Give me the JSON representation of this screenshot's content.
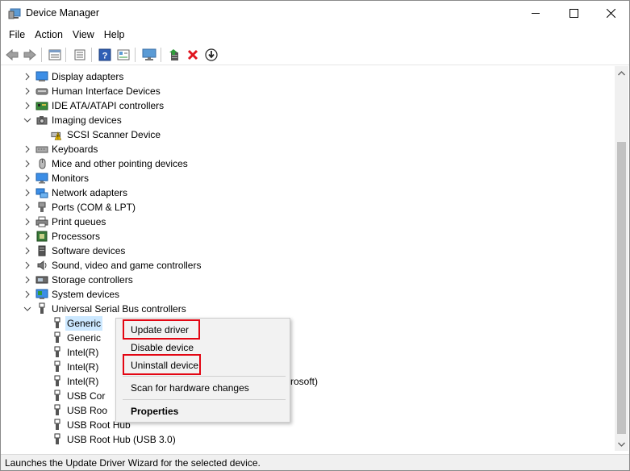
{
  "window": {
    "title": "Device Manager",
    "icon": "device-manager-icon"
  },
  "menu": [
    "File",
    "Action",
    "View",
    "Help"
  ],
  "toolbar": {
    "icons": [
      "back-icon",
      "forward-icon",
      "properties-icon",
      "grid-icon",
      "help-icon",
      "view-icon",
      "monitor-icon",
      "update-driver-icon",
      "uninstall-icon",
      "download-icon"
    ]
  },
  "tree": {
    "categories": [
      {
        "label": "Display adapters",
        "icon": "display-adapter-icon",
        "expanded": false
      },
      {
        "label": "Human Interface Devices",
        "icon": "hid-icon",
        "expanded": false
      },
      {
        "label": "IDE ATA/ATAPI controllers",
        "icon": "ide-controller-icon",
        "expanded": false
      },
      {
        "label": "Imaging devices",
        "icon": "camera-icon",
        "expanded": true
      },
      {
        "label": "SCSI Scanner Device",
        "icon": "scanner-warning-icon",
        "child": true
      },
      {
        "label": "Keyboards",
        "icon": "keyboard-icon",
        "expanded": false
      },
      {
        "label": "Mice and other pointing devices",
        "icon": "mouse-icon",
        "expanded": false
      },
      {
        "label": "Monitors",
        "icon": "monitor-icon",
        "expanded": false
      },
      {
        "label": "Network adapters",
        "icon": "network-icon",
        "expanded": false
      },
      {
        "label": "Ports (COM & LPT)",
        "icon": "port-icon",
        "expanded": false
      },
      {
        "label": "Print queues",
        "icon": "printer-icon",
        "expanded": false
      },
      {
        "label": "Processors",
        "icon": "cpu-icon",
        "expanded": false
      },
      {
        "label": "Software devices",
        "icon": "software-device-icon",
        "expanded": false
      },
      {
        "label": "Sound, video and game controllers",
        "icon": "speaker-icon",
        "expanded": false
      },
      {
        "label": "Storage controllers",
        "icon": "storage-icon",
        "expanded": false
      },
      {
        "label": "System devices",
        "icon": "system-icon",
        "expanded": false
      },
      {
        "label": "Universal Serial Bus controllers",
        "icon": "usb-icon",
        "expanded": true
      }
    ],
    "usb_children": [
      {
        "label": "Generic",
        "selected": true
      },
      {
        "label": "Generic"
      },
      {
        "label": "Intel(R)"
      },
      {
        "label": "Intel(R)"
      },
      {
        "label": "Intel(R)",
        "suffix": "rosoft)"
      },
      {
        "label": "USB Cor"
      },
      {
        "label": "USB Roo"
      },
      {
        "label": "USB Root Hub"
      },
      {
        "label": "USB Root Hub (USB 3.0)"
      }
    ]
  },
  "context_menu": {
    "update_driver": "Update driver",
    "disable_device": "Disable device",
    "uninstall_device": "Uninstall device",
    "scan": "Scan for hardware changes",
    "properties": "Properties",
    "highlight_color": "#e30613"
  },
  "status": {
    "text": "Launches the Update Driver Wizard for the selected device."
  }
}
